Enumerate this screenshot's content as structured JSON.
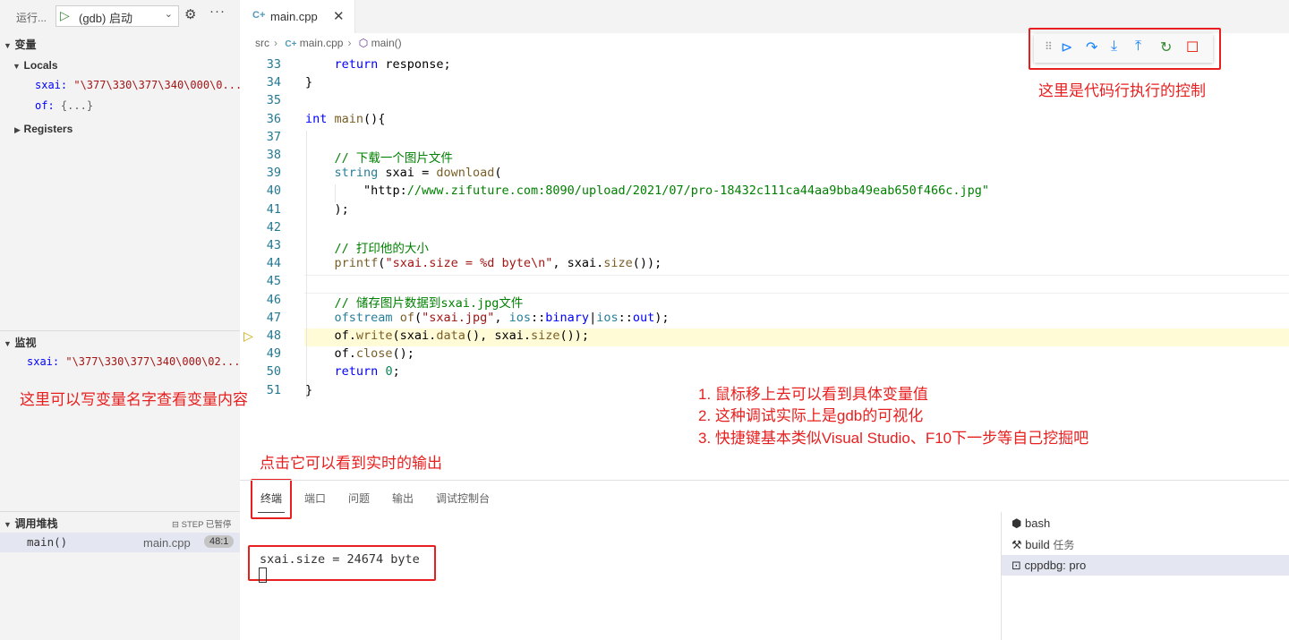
{
  "sidebar": {
    "run_label": "运行...",
    "run_config": "(gdb) 启动",
    "variables": {
      "title": "变量",
      "locals_title": "Locals",
      "locals": [
        {
          "name": "sxai:",
          "value": "\"\\377\\330\\377\\340\\000\\0..."
        },
        {
          "name": "of:",
          "value": "{...}"
        }
      ],
      "registers_title": "Registers"
    },
    "watch": {
      "title": "监视",
      "items": [
        {
          "name": "sxai:",
          "value": "\"\\377\\330\\377\\340\\000\\02..."
        }
      ]
    },
    "call_stack": {
      "title": "调用堆栈",
      "status": "STEP 已暂停",
      "frames": [
        {
          "fn": "main()",
          "file": "main.cpp",
          "pos": "48:1"
        }
      ]
    }
  },
  "editor": {
    "tab": "main.cpp",
    "breadcrumb": [
      "src",
      "main.cpp",
      "main()"
    ],
    "lines": [
      {
        "n": "33",
        "text": "    return response;"
      },
      {
        "n": "34",
        "text": "}"
      },
      {
        "n": "35",
        "text": ""
      },
      {
        "n": "36",
        "text": "int main(){"
      },
      {
        "n": "37",
        "text": ""
      },
      {
        "n": "38",
        "text": "    // 下载一个图片文件"
      },
      {
        "n": "39",
        "text": "    string sxai = download("
      },
      {
        "n": "40",
        "text": "        \"http://www.zifuture.com:8090/upload/2021/07/pro-18432c111ca44aa9bba49eab650f466c.jpg\""
      },
      {
        "n": "41",
        "text": "    );"
      },
      {
        "n": "42",
        "text": ""
      },
      {
        "n": "43",
        "text": "    // 打印他的大小"
      },
      {
        "n": "44",
        "text": "    printf(\"sxai.size = %d byte\\n\", sxai.size());"
      },
      {
        "n": "45",
        "text": ""
      },
      {
        "n": "46",
        "text": "    // 储存图片数据到sxai.jpg文件"
      },
      {
        "n": "47",
        "text": "    ofstream of(\"sxai.jpg\", ios::binary|ios::out);"
      },
      {
        "n": "48",
        "text": "    of.write(sxai.data(), sxai.size());"
      },
      {
        "n": "49",
        "text": "    of.close();"
      },
      {
        "n": "50",
        "text": "    return 0;"
      },
      {
        "n": "51",
        "text": "}"
      }
    ]
  },
  "annotations": {
    "toolbar_note": "这里是代码行执行的控制",
    "watch_note": "这里可以写变量名字查看变量内容",
    "terminal_note": "点击它可以看到实时的输出",
    "tips": [
      "1. 鼠标移上去可以看到具体变量值",
      "2. 这种调试实际上是gdb的可视化",
      "3. 快捷键基本类似Visual Studio、F10下一步等自己挖掘吧"
    ]
  },
  "panel": {
    "tabs": [
      "终端",
      "端口",
      "问题",
      "输出",
      "调试控制台"
    ],
    "terminal_output": "sxai.size = 24674 byte",
    "terminals": [
      {
        "icon": "bash-icon",
        "label": "bash",
        "sub": ""
      },
      {
        "icon": "tools-icon",
        "label": "build",
        "sub": "任务"
      },
      {
        "icon": "terminal-icon",
        "label": "cppdbg: pro",
        "sub": ""
      }
    ]
  },
  "colors": {
    "annotation_red": "#e81f1f",
    "debug_blue": "#1a85ff",
    "debug_green": "#388a34",
    "debug_red": "#e51400",
    "current_line": "#fffbd6"
  }
}
